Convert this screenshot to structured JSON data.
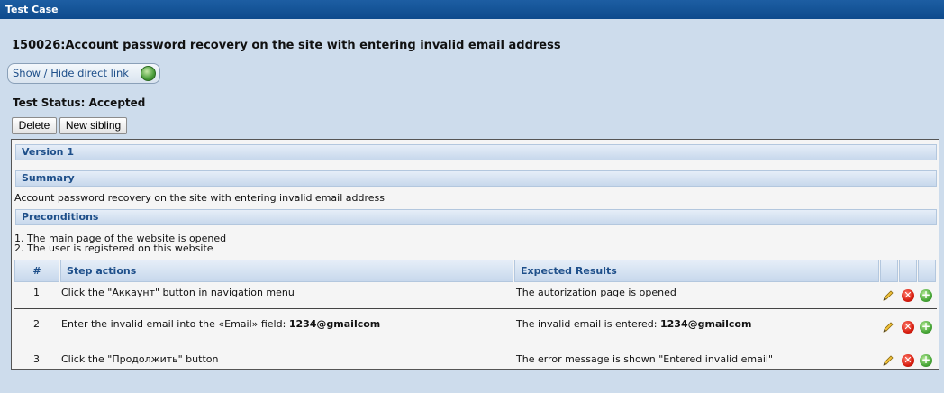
{
  "window": {
    "title": "Test Case"
  },
  "test_case": {
    "title": "150026:Account password recovery on the site with entering invalid email address",
    "direct_link_label": "Show / Hide direct link",
    "status": "Test Status: Accepted"
  },
  "actions": {
    "delete_label": "Delete",
    "sibling_label": "New sibling"
  },
  "version": {
    "label": "Version 1"
  },
  "summary": {
    "label": "Summary",
    "text": "Account password recovery on the site with entering invalid email address"
  },
  "preconditions": {
    "label": "Preconditions",
    "lines": [
      "1. The main page of the website is opened",
      "2. The user is registered on this website"
    ]
  },
  "steps_table": {
    "headers": {
      "num": "#",
      "actions": "Step actions",
      "results": "Expected Results"
    },
    "rows": [
      {
        "num": "1",
        "action": "Click the \"Аккаунт\" button in navigation menu",
        "action_bold": "",
        "result": "The autorization page is opened",
        "result_bold": ""
      },
      {
        "num": "2",
        "action": "Enter the invalid email into the «Email» field: ",
        "action_bold": "1234@gmailcom",
        "result": "The invalid email is entered: ",
        "result_bold": "1234@gmailcom"
      },
      {
        "num": "3",
        "action": "Click the \"Продолжить\" button",
        "action_bold": "",
        "result": "The error message is shown \"Entered invalid email\"",
        "result_bold": ""
      }
    ]
  },
  "icons": {
    "edit": "pencil-icon",
    "delete": "delete-x-icon",
    "add": "add-plus-icon",
    "link": "globe-link-icon"
  }
}
